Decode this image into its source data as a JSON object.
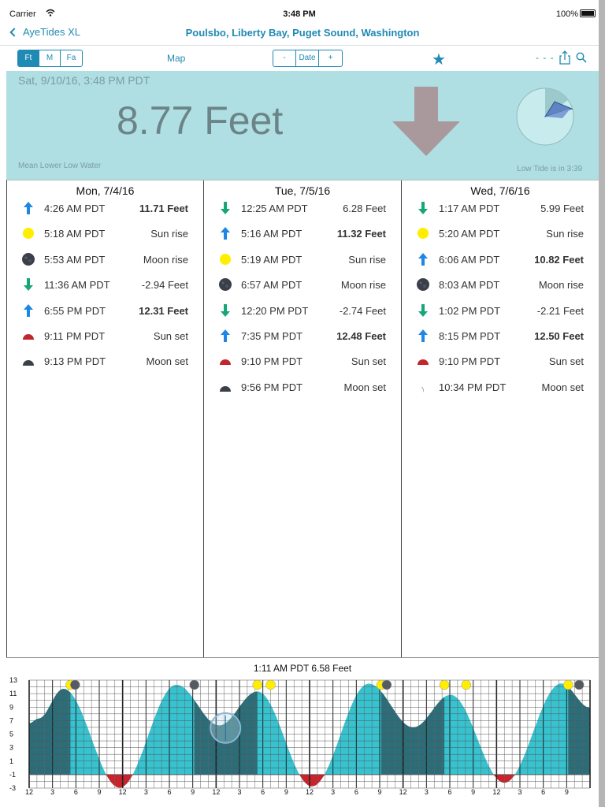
{
  "status_bar": {
    "carrier": "Carrier",
    "time": "3:48 PM",
    "battery": "100%"
  },
  "nav": {
    "back_label": "AyeTides XL",
    "title": "Poulsbo, Liberty Bay, Puget Sound, Washington"
  },
  "toolbar": {
    "units": [
      "Ft",
      "M",
      "Fa"
    ],
    "active_unit": "Ft",
    "map_label": "Map",
    "date_prev": "-",
    "date_label": "Date",
    "date_next": "+",
    "dashes": "- - -"
  },
  "banner": {
    "datetime": "Sat, 9/10/16, 3:48 PM PDT",
    "height": "8.77 Feet",
    "datum": "Mean Lower Low Water",
    "next_tide": "Low Tide is in 3:39",
    "trend": "falling"
  },
  "days": [
    {
      "header": "Mon, 7/4/16",
      "events": [
        {
          "icon": "high-tide-icon",
          "time": "4:26 AM PDT",
          "value": "11.71 Feet",
          "bold": true
        },
        {
          "icon": "sunrise-icon",
          "time": "5:18 AM PDT",
          "value": "Sun rise",
          "bold": false
        },
        {
          "icon": "moonrise-icon",
          "time": "5:53 AM PDT",
          "value": "Moon rise",
          "bold": false
        },
        {
          "icon": "low-tide-icon",
          "time": "11:36 AM PDT",
          "value": "-2.94 Feet",
          "bold": false
        },
        {
          "icon": "high-tide-icon",
          "time": "6:55 PM PDT",
          "value": "12.31 Feet",
          "bold": true
        },
        {
          "icon": "sunset-icon",
          "time": "9:11 PM PDT",
          "value": "Sun set",
          "bold": false
        },
        {
          "icon": "moonset-icon",
          "time": "9:13 PM PDT",
          "value": "Moon set",
          "bold": false
        }
      ]
    },
    {
      "header": "Tue, 7/5/16",
      "events": [
        {
          "icon": "low-tide-icon",
          "time": "12:25 AM PDT",
          "value": "6.28 Feet",
          "bold": false
        },
        {
          "icon": "high-tide-icon",
          "time": "5:16 AM PDT",
          "value": "11.32 Feet",
          "bold": true
        },
        {
          "icon": "sunrise-icon",
          "time": "5:19 AM PDT",
          "value": "Sun rise",
          "bold": false
        },
        {
          "icon": "moonrise-icon",
          "time": "6:57 AM PDT",
          "value": "Moon rise",
          "bold": false
        },
        {
          "icon": "low-tide-icon",
          "time": "12:20 PM PDT",
          "value": "-2.74 Feet",
          "bold": false
        },
        {
          "icon": "high-tide-icon",
          "time": "7:35 PM PDT",
          "value": "12.48 Feet",
          "bold": true
        },
        {
          "icon": "sunset-icon",
          "time": "9:10 PM PDT",
          "value": "Sun set",
          "bold": false
        },
        {
          "icon": "moonset-icon",
          "time": "9:56 PM PDT",
          "value": "Moon set",
          "bold": false
        }
      ]
    },
    {
      "header": "Wed, 7/6/16",
      "events": [
        {
          "icon": "low-tide-icon",
          "time": "1:17 AM PDT",
          "value": "5.99 Feet",
          "bold": false
        },
        {
          "icon": "sunrise-icon",
          "time": "5:20 AM PDT",
          "value": "Sun rise",
          "bold": false
        },
        {
          "icon": "high-tide-icon",
          "time": "6:06 AM PDT",
          "value": "10.82 Feet",
          "bold": true
        },
        {
          "icon": "moonrise-icon",
          "time": "8:03 AM PDT",
          "value": "Moon rise",
          "bold": false
        },
        {
          "icon": "low-tide-icon",
          "time": "1:02 PM PDT",
          "value": "-2.21 Feet",
          "bold": false
        },
        {
          "icon": "high-tide-icon",
          "time": "8:15 PM PDT",
          "value": "12.50 Feet",
          "bold": true
        },
        {
          "icon": "sunset-icon",
          "time": "9:10 PM PDT",
          "value": "Sun set",
          "bold": false
        },
        {
          "icon": "moonset-crescent-icon",
          "time": "10:34 PM PDT",
          "value": "Moon set",
          "bold": false
        }
      ]
    }
  ],
  "colors": {
    "accent": "#1f8ab3",
    "banner_bg": "#afdfe3",
    "tide_fill": "#36c2cf",
    "tide_night": "#2b6d78",
    "negative_fill": "#d0202a",
    "high_arrow": "#1e87e5",
    "low_arrow": "#17a57a",
    "sun": "#ffee00",
    "moon": "#3a3f4a",
    "sunset": "#c0272d",
    "trend_arrow": "#a9999c"
  },
  "chart_data": {
    "type": "area",
    "title": "1:11 AM PDT 6.58 Feet",
    "ylim": [
      -3,
      13
    ],
    "yticks": [
      13,
      11,
      9,
      7,
      5,
      3,
      1,
      -1,
      -3
    ],
    "xtick_labels": [
      "12",
      "3",
      "6",
      "9",
      "12",
      "3",
      "6",
      "9",
      "12",
      "3",
      "6",
      "9",
      "12",
      "3",
      "6",
      "9",
      "12",
      "3",
      "6",
      "9",
      "12",
      "3",
      "6",
      "9"
    ],
    "xlim_hours": [
      0,
      72
    ],
    "points": [
      {
        "x": 0.0,
        "y": 6.6
      },
      {
        "x": 1.2,
        "y": 7.3
      },
      {
        "x": 4.4,
        "y": 11.71
      },
      {
        "x": 11.6,
        "y": -2.94
      },
      {
        "x": 18.9,
        "y": 12.31
      },
      {
        "x": 24.4,
        "y": 6.28
      },
      {
        "x": 29.3,
        "y": 11.32
      },
      {
        "x": 36.3,
        "y": -2.74
      },
      {
        "x": 43.6,
        "y": 12.48
      },
      {
        "x": 49.3,
        "y": 5.99
      },
      {
        "x": 54.1,
        "y": 10.82
      },
      {
        "x": 61.0,
        "y": -2.21
      },
      {
        "x": 68.3,
        "y": 12.5
      },
      {
        "x": 72.0,
        "y": 8.9
      }
    ],
    "night_bands_hours": [
      [
        0,
        5.3
      ],
      [
        21.2,
        29.3
      ],
      [
        45.2,
        53.3
      ],
      [
        69.2,
        72
      ]
    ],
    "cursor_hour": 25.2,
    "grid": true
  }
}
